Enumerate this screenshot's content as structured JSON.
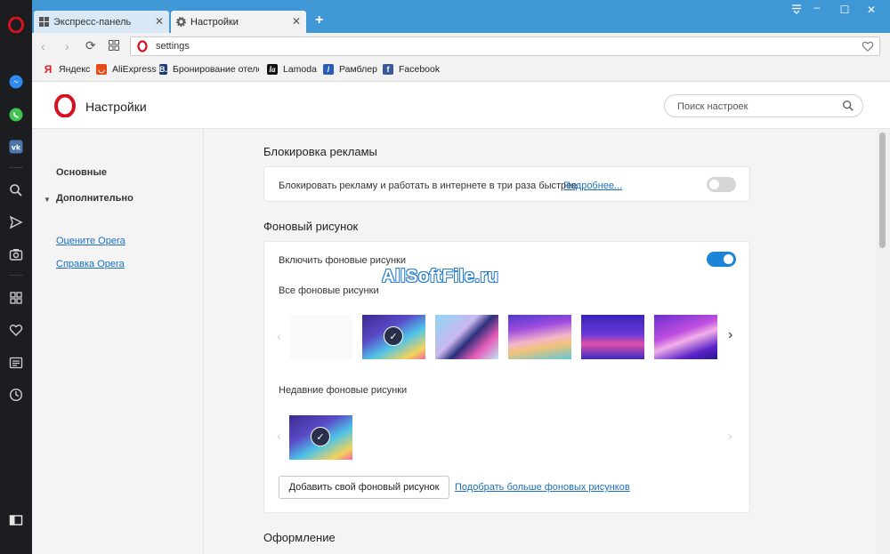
{
  "tabs": [
    {
      "label": "Экспресс-панель",
      "active": false
    },
    {
      "label": "Настройки",
      "active": true
    }
  ],
  "address": {
    "url": "settings"
  },
  "bookmarks": [
    {
      "label": "Яндекс",
      "icon": "yandex-icon",
      "color": "#e31e24"
    },
    {
      "label": "AliExpress",
      "icon": "aliexpress-icon",
      "color": "#e64a19"
    },
    {
      "label": "Бронирование отеле",
      "icon": "booking-icon",
      "color": "#1b3a7a"
    },
    {
      "label": "Lamoda",
      "icon": "lamoda-icon",
      "color": "#111111"
    },
    {
      "label": "Рамблер",
      "icon": "rambler-icon",
      "color": "#2a5cb8"
    },
    {
      "label": "Facebook",
      "icon": "facebook-icon",
      "color": "#3b5998"
    }
  ],
  "header": {
    "title": "Настройки",
    "search_placeholder": "Поиск настроек"
  },
  "nav": {
    "items": [
      "Основные",
      "Дополнительно"
    ],
    "links": [
      "Оцените Opera",
      "Справка Opera"
    ]
  },
  "adblock": {
    "section_title": "Блокировка рекламы",
    "text": "Блокировать рекламу и работать в интернете в три раза быстрее",
    "link": "Подробнее...",
    "enabled": false
  },
  "wallpaper": {
    "section_title": "Фоновый рисунок",
    "enable_label": "Включить фоновые рисунки",
    "enabled": true,
    "all_label": "Все фоновые рисунки",
    "recent_label": "Недавние фоновые рисунки",
    "add_button": "Добавить свой фоновый рисунок",
    "more_link": "Подобрать больше фоновых рисунков"
  },
  "next_section": "Оформление",
  "watermark": "AllSoftFile.ru",
  "colors": {
    "accent": "#3f97d6",
    "toggle_on": "#1b86d9",
    "link": "#1a6fc0",
    "opera_red": "#d6121f"
  }
}
